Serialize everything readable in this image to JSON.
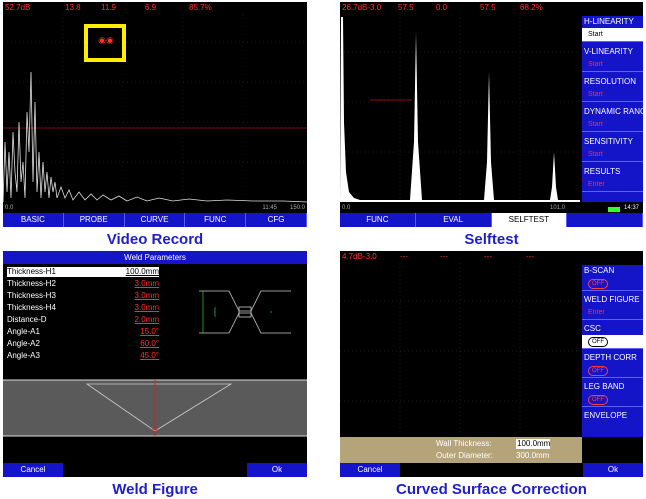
{
  "panel_video": {
    "status": {
      "gain": "52.7dB",
      "a": "13.8",
      "b": "11.9",
      "c": "6.9",
      "d": "85.7%"
    },
    "axis": {
      "left": "0.0",
      "right": "150.0"
    },
    "bottom_readout": {
      "time": "11:45"
    },
    "tabs": [
      "BASIC",
      "PROBE",
      "CURVE",
      "FUNC",
      "CFG"
    ],
    "caption": "Video Record"
  },
  "panel_selftest": {
    "status": {
      "gain": "26.7dB-3.0",
      "a": "57.5",
      "b": "0.0",
      "c": "57.5",
      "d": "68.2%"
    },
    "sidebar": [
      {
        "label": "H-LINEARITY",
        "value": "Start",
        "selected": true
      },
      {
        "label": "V-LINEARITY",
        "value": "Start"
      },
      {
        "label": "RESOLUTION",
        "value": "Start"
      },
      {
        "label": "DYNAMIC RANGE",
        "value": "Start"
      },
      {
        "label": "SENSITIVITY",
        "value": "Start"
      },
      {
        "label": "RESULTS",
        "value": "Enter"
      }
    ],
    "axis": {
      "left": "0.0",
      "right": "101.0"
    },
    "bottom_readout": {
      "time": "14:37"
    },
    "tabs": [
      "FUNC",
      "EVAL",
      "SELFTEST"
    ],
    "active_tab": "SELFTEST",
    "caption": "Selftest"
  },
  "panel_weld": {
    "title": "Weld Parameters",
    "rows": [
      {
        "label": "Thickness-H1",
        "value": "100.0mm"
      },
      {
        "label": "Thickness-H2",
        "value": "3.0mm"
      },
      {
        "label": "Thickness-H3",
        "value": "3.0mm"
      },
      {
        "label": "Thickness-H4",
        "value": "3.0mm"
      },
      {
        "label": "Distance-D",
        "value": "2.0mm"
      },
      {
        "label": "Angle-A1",
        "value": "15.0°"
      },
      {
        "label": "Angle-A2",
        "value": "60.0°"
      },
      {
        "label": "Angle-A3",
        "value": "45.0°"
      }
    ],
    "cancel": "Cancel",
    "ok": "Ok",
    "caption": "Weld Figure"
  },
  "panel_curved": {
    "status": {
      "gain": "4.7dB-3.0",
      "a": "---",
      "b": "---",
      "c": "---",
      "d": "---"
    },
    "sidebar": [
      {
        "label": "B-SCAN",
        "value": "OFF",
        "pill": true
      },
      {
        "label": "WELD FIGURE",
        "value": "Enter"
      },
      {
        "label": "CSC",
        "value": "OFF",
        "pill": true,
        "selected": true
      },
      {
        "label": "DEPTH CORR",
        "value": "OFF",
        "pill": true
      },
      {
        "label": "LEG BAND",
        "value": "OFF",
        "pill": true
      },
      {
        "label": "ENVELOPE",
        "value": ""
      }
    ],
    "wall_thickness_label": "Wall Thickness:",
    "wall_thickness_value": "100.0mm",
    "outer_diameter_label": "Outer Diameter:",
    "outer_diameter_value": "300.0mm",
    "cancel": "Cancel",
    "ok": "Ok",
    "caption": "Curved Surface Correction"
  },
  "colors": {
    "accent": "#1414c8",
    "readout": "#ff3030",
    "caption": "#1f1fc8",
    "tan_dialog": "#b5a37a"
  }
}
